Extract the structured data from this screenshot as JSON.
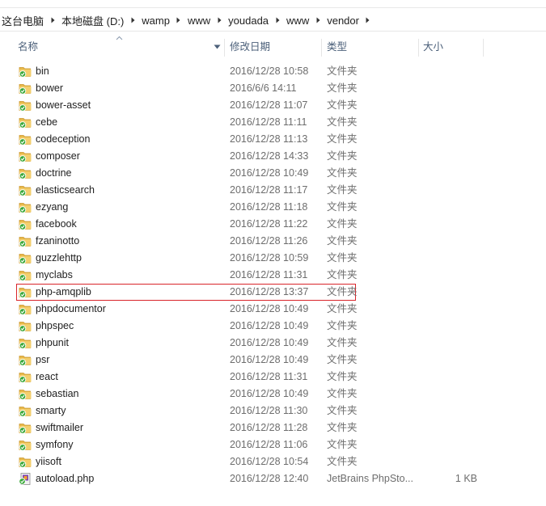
{
  "breadcrumb": [
    {
      "label": "这台电脑"
    },
    {
      "label": "本地磁盘 (D:)"
    },
    {
      "label": "wamp"
    },
    {
      "label": "www"
    },
    {
      "label": "youdada"
    },
    {
      "label": "www"
    },
    {
      "label": "vendor"
    }
  ],
  "columns": {
    "name": "名称",
    "date": "修改日期",
    "type": "类型",
    "size": "大小"
  },
  "files": [
    {
      "name": "bin",
      "date": "2016/12/28 10:58",
      "type": "文件夹",
      "size": "",
      "icon": "folder-icon"
    },
    {
      "name": "bower",
      "date": "2016/6/6 14:11",
      "type": "文件夹",
      "size": "",
      "icon": "folder-icon"
    },
    {
      "name": "bower-asset",
      "date": "2016/12/28 11:07",
      "type": "文件夹",
      "size": "",
      "icon": "folder-icon"
    },
    {
      "name": "cebe",
      "date": "2016/12/28 11:11",
      "type": "文件夹",
      "size": "",
      "icon": "folder-icon"
    },
    {
      "name": "codeception",
      "date": "2016/12/28 11:13",
      "type": "文件夹",
      "size": "",
      "icon": "folder-icon"
    },
    {
      "name": "composer",
      "date": "2016/12/28 14:33",
      "type": "文件夹",
      "size": "",
      "icon": "folder-icon"
    },
    {
      "name": "doctrine",
      "date": "2016/12/28 10:49",
      "type": "文件夹",
      "size": "",
      "icon": "folder-icon"
    },
    {
      "name": "elasticsearch",
      "date": "2016/12/28 11:17",
      "type": "文件夹",
      "size": "",
      "icon": "folder-icon"
    },
    {
      "name": "ezyang",
      "date": "2016/12/28 11:18",
      "type": "文件夹",
      "size": "",
      "icon": "folder-icon"
    },
    {
      "name": "facebook",
      "date": "2016/12/28 11:22",
      "type": "文件夹",
      "size": "",
      "icon": "folder-icon"
    },
    {
      "name": "fzaninotto",
      "date": "2016/12/28 11:26",
      "type": "文件夹",
      "size": "",
      "icon": "folder-icon"
    },
    {
      "name": "guzzlehttp",
      "date": "2016/12/28 10:59",
      "type": "文件夹",
      "size": "",
      "icon": "folder-icon"
    },
    {
      "name": "myclabs",
      "date": "2016/12/28 11:31",
      "type": "文件夹",
      "size": "",
      "icon": "folder-icon"
    },
    {
      "name": "php-amqplib",
      "date": "2016/12/28 13:37",
      "type": "文件夹",
      "size": "",
      "icon": "folder-icon",
      "highlighted": true
    },
    {
      "name": "phpdocumentor",
      "date": "2016/12/28 10:49",
      "type": "文件夹",
      "size": "",
      "icon": "folder-icon"
    },
    {
      "name": "phpspec",
      "date": "2016/12/28 10:49",
      "type": "文件夹",
      "size": "",
      "icon": "folder-icon"
    },
    {
      "name": "phpunit",
      "date": "2016/12/28 10:49",
      "type": "文件夹",
      "size": "",
      "icon": "folder-icon"
    },
    {
      "name": "psr",
      "date": "2016/12/28 10:49",
      "type": "文件夹",
      "size": "",
      "icon": "folder-icon"
    },
    {
      "name": "react",
      "date": "2016/12/28 11:31",
      "type": "文件夹",
      "size": "",
      "icon": "folder-icon"
    },
    {
      "name": "sebastian",
      "date": "2016/12/28 10:49",
      "type": "文件夹",
      "size": "",
      "icon": "folder-icon"
    },
    {
      "name": "smarty",
      "date": "2016/12/28 11:30",
      "type": "文件夹",
      "size": "",
      "icon": "folder-icon"
    },
    {
      "name": "swiftmailer",
      "date": "2016/12/28 11:28",
      "type": "文件夹",
      "size": "",
      "icon": "folder-icon"
    },
    {
      "name": "symfony",
      "date": "2016/12/28 11:06",
      "type": "文件夹",
      "size": "",
      "icon": "folder-icon"
    },
    {
      "name": "yiisoft",
      "date": "2016/12/28 10:54",
      "type": "文件夹",
      "size": "",
      "icon": "folder-icon"
    },
    {
      "name": "autoload.php",
      "date": "2016/12/28 12:40",
      "type": "JetBrains PhpSto...",
      "size": "1 KB",
      "icon": "php-file-icon"
    }
  ],
  "colors": {
    "folder": "#e8b94a",
    "sync_badge": "#3aa83a",
    "highlight_border": "#d9252a",
    "header_text": "#4c607a"
  }
}
